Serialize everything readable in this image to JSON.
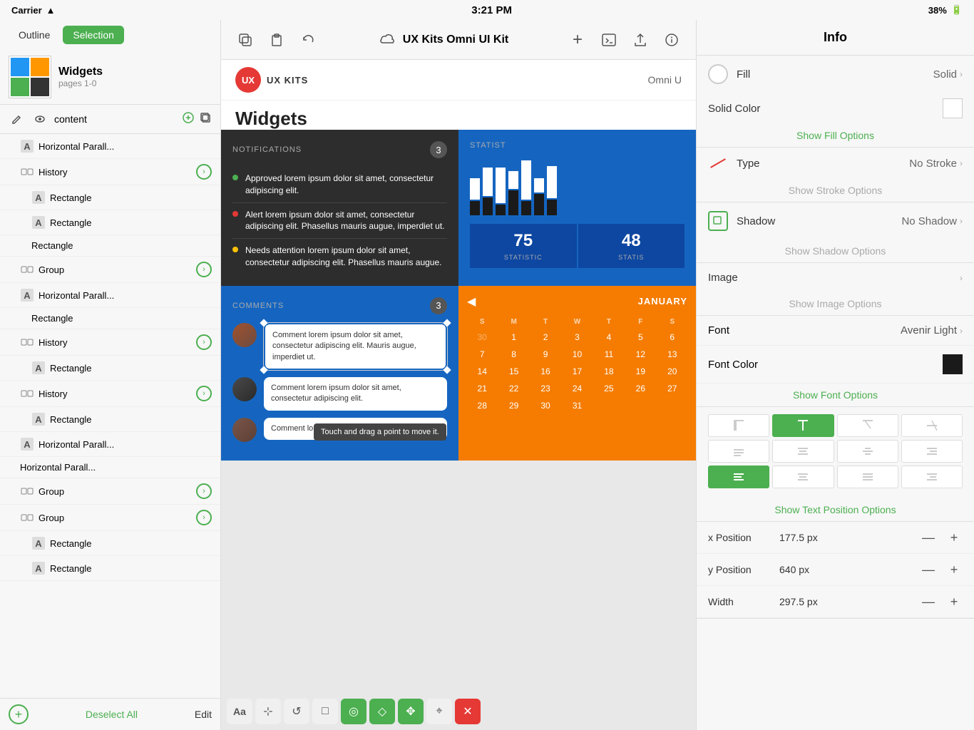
{
  "statusBar": {
    "carrier": "Carrier",
    "wifi": "wifi",
    "time": "3:21 PM",
    "battery": "38%"
  },
  "tabs": {
    "outline": "Outline",
    "selection": "Selection"
  },
  "document": {
    "title": "Widgets",
    "pages": "pages 1-0"
  },
  "layerToolbar": {
    "layerName": "content"
  },
  "layers": [
    {
      "id": 1,
      "indent": 1,
      "icon": "text",
      "label": "Horizontal Parall...",
      "hasArrow": false
    },
    {
      "id": 2,
      "indent": 1,
      "icon": "group",
      "label": "History",
      "hasArrow": true
    },
    {
      "id": 3,
      "indent": 2,
      "icon": "text",
      "label": "Rectangle",
      "hasArrow": false
    },
    {
      "id": 4,
      "indent": 2,
      "icon": "text",
      "label": "Rectangle",
      "hasArrow": false
    },
    {
      "id": 5,
      "indent": 2,
      "icon": "none",
      "label": "Rectangle",
      "hasArrow": false
    },
    {
      "id": 6,
      "indent": 1,
      "icon": "group",
      "label": "Group",
      "hasArrow": true
    },
    {
      "id": 7,
      "indent": 1,
      "icon": "text",
      "label": "Horizontal Parall...",
      "hasArrow": false
    },
    {
      "id": 8,
      "indent": 2,
      "icon": "none",
      "label": "Rectangle",
      "hasArrow": false
    },
    {
      "id": 9,
      "indent": 1,
      "icon": "group",
      "label": "History",
      "hasArrow": true
    },
    {
      "id": 10,
      "indent": 2,
      "icon": "text",
      "label": "Rectangle",
      "hasArrow": false
    },
    {
      "id": 11,
      "indent": 1,
      "icon": "group",
      "label": "History",
      "hasArrow": true
    },
    {
      "id": 12,
      "indent": 2,
      "icon": "text",
      "label": "Rectangle",
      "hasArrow": false
    },
    {
      "id": 13,
      "indent": 1,
      "icon": "text",
      "label": "Horizontal Parall...",
      "hasArrow": false
    },
    {
      "id": 14,
      "indent": 1,
      "icon": "none",
      "label": "Horizontal Parall...",
      "hasArrow": false
    },
    {
      "id": 15,
      "indent": 1,
      "icon": "group",
      "label": "Group",
      "hasArrow": true
    },
    {
      "id": 16,
      "indent": 1,
      "icon": "group",
      "label": "Group",
      "hasArrow": true
    },
    {
      "id": 17,
      "indent": 2,
      "icon": "text",
      "label": "Rectangle",
      "hasArrow": false
    },
    {
      "id": 18,
      "indent": 2,
      "icon": "text",
      "label": "Rectangle",
      "hasArrow": false
    }
  ],
  "footer": {
    "deselect": "Deselect All",
    "edit": "Edit"
  },
  "toolbar": {
    "appName": "UX Kits Omni UI Kit",
    "icons": [
      "copy",
      "paste",
      "undo",
      "cloud",
      "add",
      "terminal",
      "share",
      "info"
    ]
  },
  "page": {
    "logoText": "UX KITS",
    "headerRight": "Omni U",
    "pageTitle": "Widgets"
  },
  "notifications": {
    "title": "NOTIFICATIONS",
    "count": "3",
    "items": [
      {
        "color": "green",
        "text": "Approved lorem ipsum dolor sit amet, consectetur adipiscing elit."
      },
      {
        "color": "red",
        "text": "Alert lorem ipsum dolor sit amet, consectetur adipiscing elit. Phasellus mauris augue, imperdiet ut."
      },
      {
        "color": "yellow",
        "text": "Needs attention lorem ipsum dolor sit amet, consectetur adipiscing elit. Phasellus mauris augue."
      }
    ]
  },
  "stats": {
    "title": "STATIST",
    "bars": [
      {
        "white": 60,
        "black": 30
      },
      {
        "white": 70,
        "black": 40
      },
      {
        "white": 80,
        "black": 20
      },
      {
        "white": 50,
        "black": 60
      },
      {
        "white": 90,
        "black": 30
      },
      {
        "white": 40,
        "black": 50
      },
      {
        "white": 75,
        "black": 35
      }
    ],
    "numbers": [
      {
        "value": "75",
        "label": "STATISTIC"
      },
      {
        "value": "48",
        "label": "STATIS"
      }
    ]
  },
  "comments": {
    "title": "COMMENTS",
    "count": "3",
    "items": [
      {
        "text": "Comment lorem ipsum dolor sit amet, consectetur adipiscing elit. Mauris augue, imperdiet ut."
      },
      {
        "text": "Comment lorem ipsum dolor sit amet, consectetur adipiscing elit."
      },
      {
        "text": "Comment lorem ipsum dolor sit amet,"
      }
    ],
    "tooltip": "Touch and drag a point to move it."
  },
  "calendar": {
    "month": "JANUARY",
    "prevArrow": "◀",
    "dayHeaders": [
      "S",
      "M",
      "T",
      "W",
      "T",
      "F",
      "S"
    ],
    "weeks": [
      [
        "30",
        "1",
        "2",
        "3",
        "4",
        "5",
        "6"
      ],
      [
        "7",
        "8",
        "9",
        "10",
        "11",
        "12",
        "13"
      ],
      [
        "14",
        "15",
        "16",
        "17",
        "18",
        "19",
        "20"
      ],
      [
        "21",
        "22",
        "23",
        "24",
        "25",
        "26",
        "27"
      ],
      [
        "28",
        "29",
        "30",
        "31",
        "",
        "",
        ""
      ]
    ],
    "prevDays": [
      "30"
    ]
  },
  "infoPanel": {
    "title": "Info",
    "fill": {
      "label": "Fill",
      "type": "Solid"
    },
    "solidColor": {
      "label": "Solid Color"
    },
    "showFillOptions": "Show Fill Options",
    "stroke": {
      "label": "Type",
      "type": "No Stroke",
      "showOptions": "Show Stroke Options"
    },
    "shadow": {
      "label": "Shadow",
      "type": "No Shadow",
      "showOptions": "Show Shadow Options"
    },
    "image": {
      "label": "Image",
      "showOptions": "Show Image Options"
    },
    "font": {
      "label": "Font",
      "value": "Avenir Light"
    },
    "fontColor": {
      "label": "Font Color"
    },
    "showFontOptions": "Show Font Options",
    "showTextPositionOptions": "Show Text Position Options",
    "position": {
      "xLabel": "x Position",
      "xValue": "177.5 px",
      "yLabel": "y Position",
      "yValue": "640 px",
      "wLabel": "Width",
      "wValue": "297.5 px"
    }
  },
  "tools": [
    {
      "id": "text",
      "icon": "Aa",
      "active": false
    },
    {
      "id": "select",
      "icon": "⊹",
      "active": false
    },
    {
      "id": "rotate",
      "icon": "↺",
      "active": false
    },
    {
      "id": "rect",
      "icon": "□",
      "active": false
    },
    {
      "id": "target",
      "icon": "◎",
      "active": true
    },
    {
      "id": "diamond",
      "icon": "◇",
      "active": false
    },
    {
      "id": "move",
      "icon": "✥",
      "active": true
    },
    {
      "id": "anchor",
      "icon": "⌖",
      "active": false
    },
    {
      "id": "close",
      "icon": "✕",
      "active": false
    }
  ]
}
